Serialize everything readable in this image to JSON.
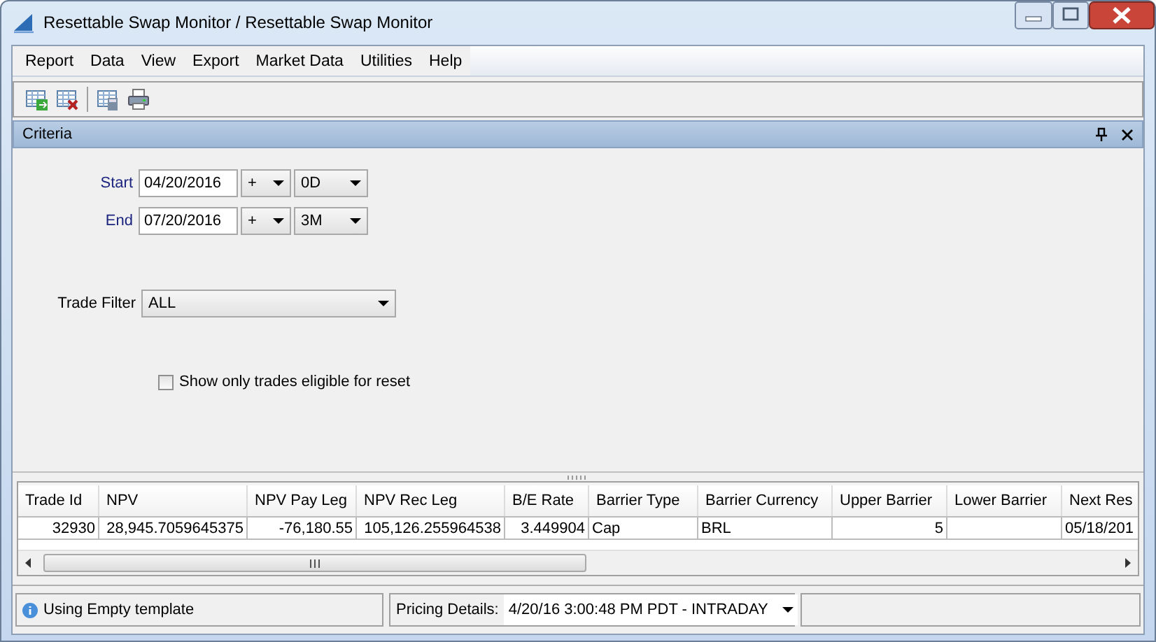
{
  "window": {
    "title": "Resettable Swap Monitor / Resettable Swap Monitor"
  },
  "menu": [
    "Report",
    "Data",
    "View",
    "Export",
    "Market Data",
    "Utilities",
    "Help"
  ],
  "criteria": {
    "title": "Criteria",
    "dates": [
      {
        "label": "Start",
        "value": "04/20/2016",
        "sign": "+",
        "tenor": "0D"
      },
      {
        "label": "End",
        "value": "07/20/2016",
        "sign": "+",
        "tenor": "3M"
      }
    ],
    "trade_filter": {
      "label": "Trade Filter",
      "value": "ALL"
    },
    "reset_only": {
      "label": "Show only trades eligible for reset",
      "checked": false
    }
  },
  "table": {
    "columns": [
      {
        "label": "Trade Id",
        "kind": "number"
      },
      {
        "label": "NPV",
        "kind": "number"
      },
      {
        "label": "NPV Pay Leg",
        "kind": "number"
      },
      {
        "label": "NPV Rec Leg",
        "kind": "number"
      },
      {
        "label": "B/E Rate",
        "kind": "number"
      },
      {
        "label": "Barrier Type",
        "kind": "text"
      },
      {
        "label": "Barrier Currency",
        "kind": "text"
      },
      {
        "label": "Upper Barrier",
        "kind": "number"
      },
      {
        "label": "Lower Barrier",
        "kind": "number"
      },
      {
        "label": "Next Res",
        "kind": "text"
      }
    ],
    "rows": [
      [
        "32930",
        "28,945.7059645375",
        "-76,180.55",
        "105,126.255964538",
        "3.449904",
        "Cap",
        "BRL",
        "5",
        "",
        "05/18/201"
      ]
    ]
  },
  "status_bar": {
    "message": "Using Empty template",
    "pricing_label": "Pricing Details:",
    "pricing_value": "4/20/16 3:00:48 PM PDT - INTRADAY"
  }
}
